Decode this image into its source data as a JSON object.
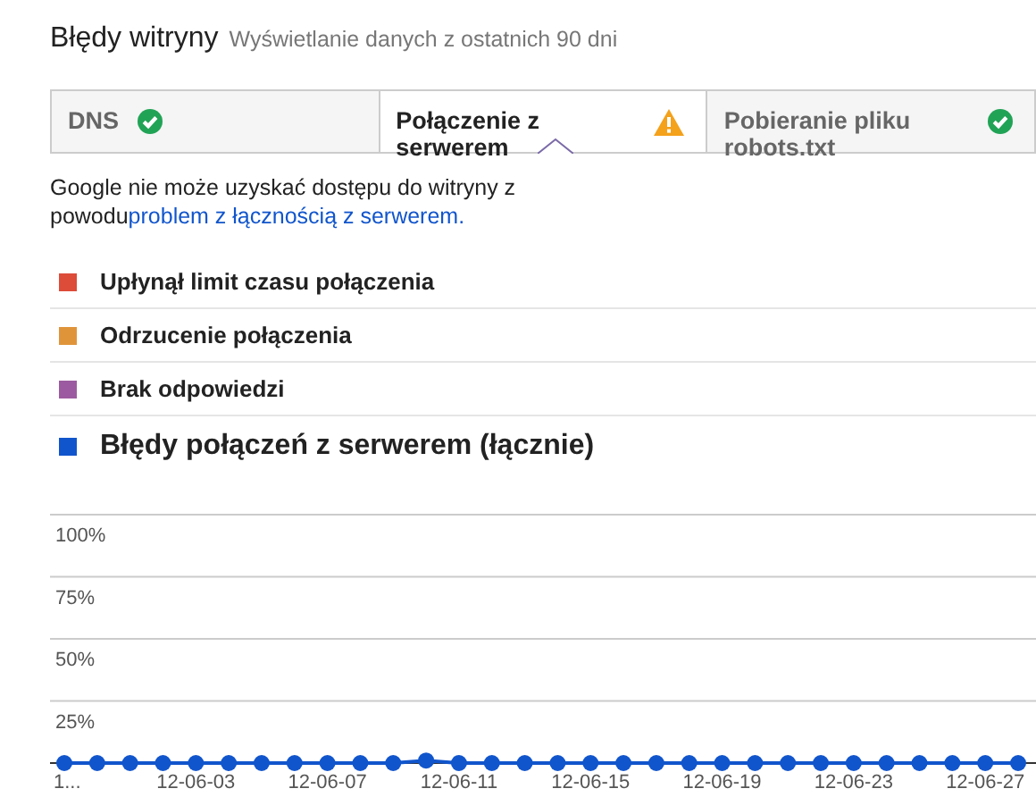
{
  "header": {
    "title": "Błędy witryny",
    "subtitle": "Wyświetlanie danych z ostatnich 90 dni"
  },
  "tabs": [
    {
      "label": "DNS",
      "kind": "ok",
      "selected": false
    },
    {
      "label": "Połączenie z serwerem",
      "kind": "warning",
      "selected": true
    },
    {
      "label": "Pobieranie pliku robots.txt",
      "kind": "ok",
      "selected": false
    }
  ],
  "message": {
    "text": "Google nie może uzyskać dostępu do witryny z powodu",
    "link": "problem z łącznością z serwerem."
  },
  "legend": [
    {
      "label": "Upłynął limit czasu połączenia",
      "color": "#dd4b39",
      "kind": "series"
    },
    {
      "label": "Odrzucenie połączenia",
      "color": "#e0943a",
      "kind": "series"
    },
    {
      "label": "Brak odpowiedzi",
      "color": "#9c5ba0",
      "kind": "series"
    },
    {
      "label": "Błędy połączeń z serwerem (łącznie)",
      "color": "#1155cc",
      "kind": "total"
    }
  ],
  "chart": {
    "chart_data": {
      "type": "line",
      "categories": [
        "1...",
        null,
        null,
        null,
        "12-06-03",
        null,
        null,
        null,
        "12-06-07",
        null,
        null,
        null,
        "12-06-11",
        null,
        null,
        null,
        "12-06-15",
        null,
        null,
        null,
        "12-06-19",
        null,
        null,
        null,
        "12-06-23",
        null,
        null,
        null,
        "12-06-27",
        null
      ],
      "values": [
        0,
        0,
        0,
        0,
        0,
        0,
        0,
        0,
        0,
        0,
        0,
        1,
        0,
        0,
        0,
        0,
        0,
        0,
        0,
        0,
        0,
        0,
        0,
        0,
        0,
        0,
        0,
        0,
        0,
        0
      ],
      "ylim": [
        0,
        100
      ],
      "grid": true,
      "marker": true,
      "yticks": [
        {
          "value": 25,
          "label": "25%"
        },
        {
          "value": 50,
          "label": "50%"
        },
        {
          "value": 75,
          "label": "75%"
        },
        {
          "value": 100,
          "label": "100%"
        }
      ]
    }
  }
}
